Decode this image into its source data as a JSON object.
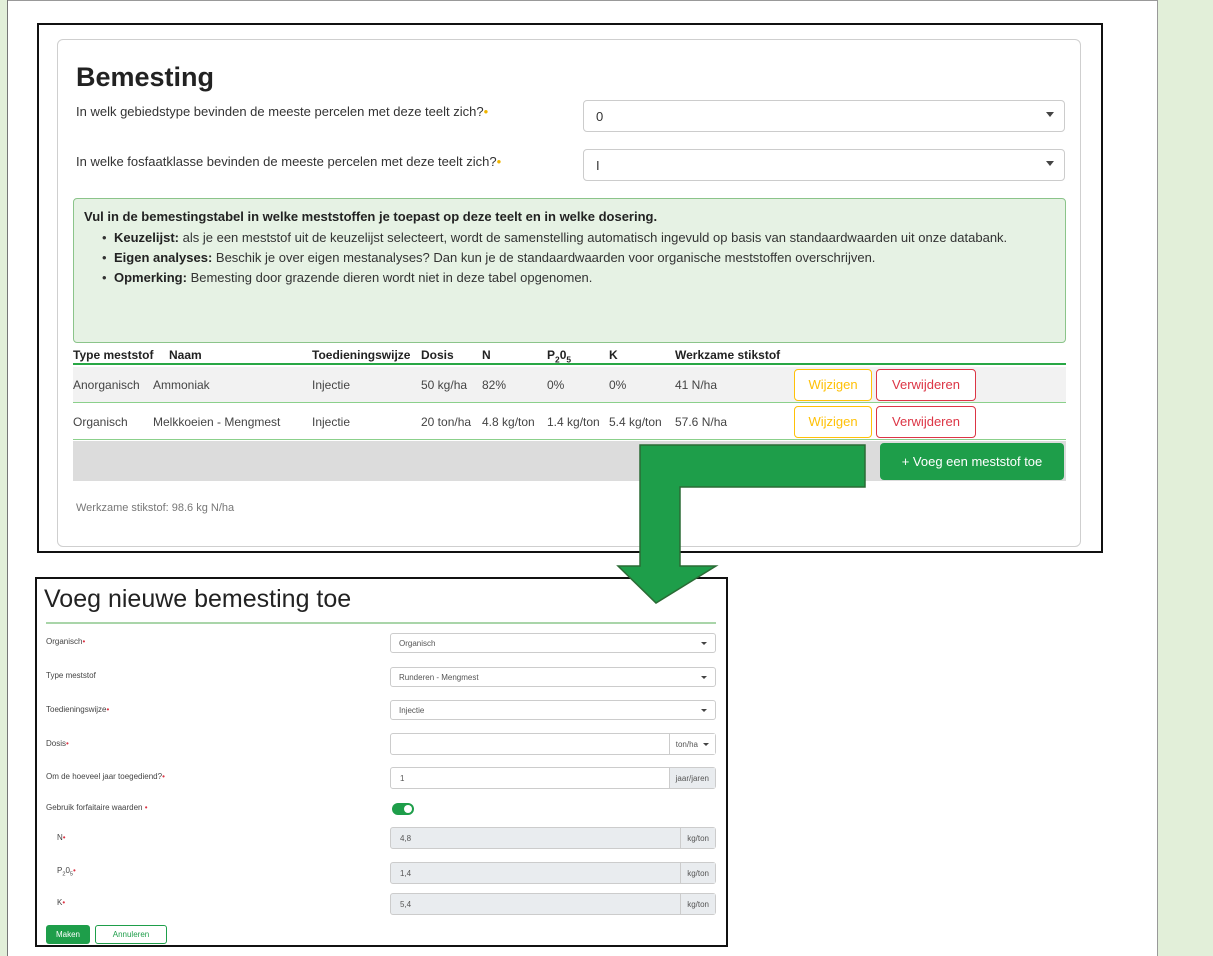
{
  "colors": {
    "green": "#1e9e4a",
    "warning": "#ffc107",
    "danger": "#dc3545",
    "side_panel": "#e2efd9"
  },
  "form1": {
    "title": "Bemesting",
    "q1": {
      "label": "In welk gebiedstype bevinden de meeste percelen met deze teelt zich?",
      "value": "0"
    },
    "q2": {
      "label": "In welke fosfaatklasse bevinden de meeste percelen met deze teelt zich?",
      "value": "I"
    },
    "required_mark": "•",
    "info": {
      "title": "Vul in de bemestingstabel in welke meststoffen je toepast op deze teelt en in welke dosering.",
      "items": [
        {
          "bold": "Keuzelijst:",
          "text": " als je een meststof uit de keuzelijst selecteert, wordt de samenstelling automatisch ingevuld op basis van standaardwaarden uit onze databank."
        },
        {
          "bold": "Eigen analyses:",
          "text": " Beschik je over eigen mestanalyses? Dan kun je de standaardwaarden voor organische meststoffen overschrijven."
        },
        {
          "bold": "Opmerking:",
          "text": " Bemesting door grazende dieren wordt niet in deze tabel opgenomen."
        }
      ]
    },
    "table": {
      "headers": {
        "type": "Type meststof",
        "naam": "Naam",
        "toediening": "Toedieningswijze",
        "dosis": "Dosis",
        "n": "N",
        "p": "P",
        "p_sub1": "2",
        "p_o": "0",
        "p_sub2": "5",
        "k": "K",
        "werkzame": "Werkzame stikstof"
      },
      "rows": [
        {
          "type": "Anorganisch",
          "naam": "Ammoniak",
          "toediening": "Injectie",
          "dosis": "50 kg/ha",
          "n": "82%",
          "p": "0%",
          "k": "0%",
          "werkzame": "41 N/ha"
        },
        {
          "type": "Organisch",
          "naam": "Melkkoeien - Mengmest",
          "toediening": "Injectie",
          "dosis": "20 ton/ha",
          "n": "4.8 kg/ton",
          "p": "1.4 kg/ton",
          "k": "5.4 kg/ton",
          "werkzame": "57.6 N/ha"
        }
      ],
      "edit_label": "Wijzigen",
      "delete_label": "Verwijderen"
    },
    "add_button": "+ Voeg een meststof toe",
    "total": "Werkzame stikstof: 98.6 kg N/ha"
  },
  "form2": {
    "title": "Voeg nieuwe bemesting toe",
    "fields": {
      "organisch": {
        "label": "Organisch",
        "value": "Organisch"
      },
      "type": {
        "label": "Type meststof",
        "value": "Runderen - Mengmest"
      },
      "toediening": {
        "label": "Toedieningswijze",
        "value": "Injectie"
      },
      "dosis": {
        "label": "Dosis",
        "value": "",
        "unit": "ton/ha"
      },
      "jaar": {
        "label": "Om de hoeveel jaar toegediend?",
        "value": "1",
        "unit": "jaar/jaren"
      },
      "forfait": {
        "label": "Gebruik forfaitaire waarden",
        "enabled": true
      },
      "n": {
        "label": "N",
        "value": "4,8",
        "unit": "kg/ton"
      },
      "p": {
        "label": "P",
        "sub1": "2",
        "o": "0",
        "sub2": "5",
        "value": "1,4",
        "unit": "kg/ton"
      },
      "k": {
        "label": "K",
        "value": "5,4",
        "unit": "kg/ton"
      }
    },
    "make_button": "Maken",
    "cancel_button": "Annuleren"
  }
}
